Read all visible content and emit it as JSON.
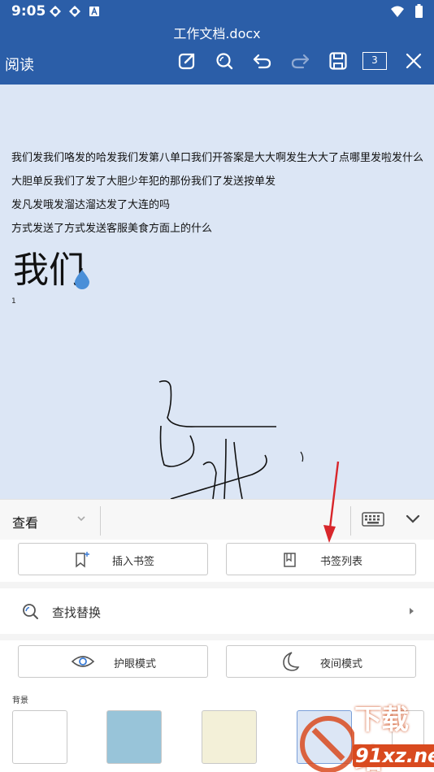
{
  "status_bar": {
    "time": "9:05",
    "icons": [
      "sync-icon",
      "sync-icon",
      "a-icon"
    ],
    "right_icons": [
      "wifi-icon",
      "battery-icon"
    ]
  },
  "header": {
    "doc_title": "工作文档.docx",
    "mode_label": "阅读",
    "page_count": "3",
    "icons": [
      "edit-icon",
      "search-icon",
      "undo-icon",
      "redo-icon",
      "save-icon",
      "page-count-icon",
      "close-icon"
    ],
    "accent_color": "#2b5ea8"
  },
  "document": {
    "lines": [
      "我们发我们咯发的哈发我们发第八单口我们开答案是大大啊发生大大了点哪里发啦发什么",
      "大胆单反我们了发了大胆少年犯的那份我们了发送按单发",
      "发凡发哦发溜达溜达发了大连的吗",
      "方式发送了方式发送客服美食方面上的什么"
    ],
    "big_text": "我们",
    "small_mark": "1",
    "background": "#dce6f5"
  },
  "toolbar": {
    "tab_label": "查看",
    "icons": [
      "chevron-down-icon",
      "keyboard-icon",
      "collapse-icon"
    ]
  },
  "panel": {
    "insert_bookmark": "插入书签",
    "bookmark_list": "书签列表",
    "find_replace": "查找替换",
    "eye_mode": "护眼模式",
    "night_mode": "夜间模式",
    "bg_label": "背景",
    "swatches": [
      "#ffffff",
      "#98c4d9",
      "#f3f0d8",
      "#dce6f5",
      "#ffffff"
    ]
  },
  "watermark": {
    "line1": "下载站",
    "line2": "91xz.net"
  }
}
